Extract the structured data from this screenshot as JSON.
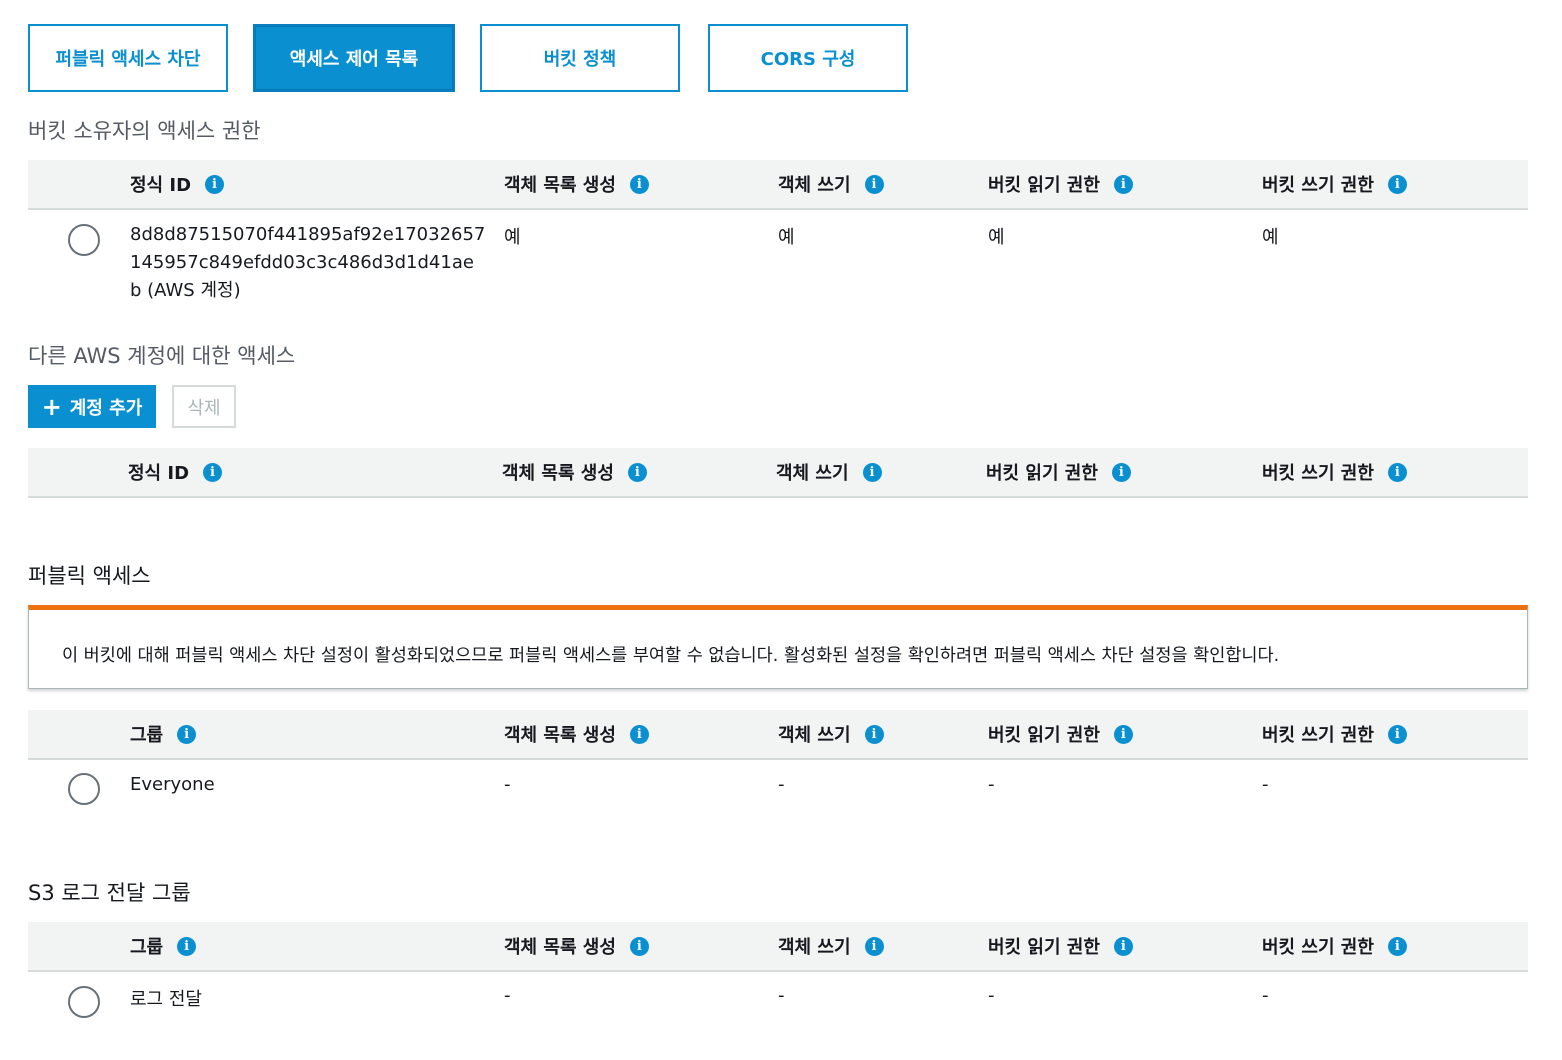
{
  "tabs": [
    {
      "label": "퍼블릭 액세스 차단",
      "active": false
    },
    {
      "label": "액세스 제어 목록",
      "active": true
    },
    {
      "label": "버킷 정책",
      "active": false
    },
    {
      "label": "CORS 구성",
      "active": false
    }
  ],
  "owner_section": {
    "title": "버킷 소유자의 액세스 권한",
    "columns": [
      "정식 ID",
      "객체 목록 생성",
      "객체 쓰기",
      "버킷 읽기 권한",
      "버킷 쓰기 권한"
    ],
    "row": {
      "id_lines": [
        "8d8d87515070f441895af92e17032657",
        "145957c849efdd03c3c486d3d1d41ae",
        "b (AWS 계정)"
      ],
      "list_objects": "예",
      "write_objects": "예",
      "read_bucket": "예",
      "write_bucket": "예"
    }
  },
  "other_accounts": {
    "title": "다른 AWS 계정에 대한 액세스",
    "add_button": "계정 추가",
    "delete_button": "삭제",
    "columns": [
      "정식 ID",
      "객체 목록 생성",
      "객체 쓰기",
      "버킷 읽기 권한",
      "버킷 쓰기 권한"
    ]
  },
  "public_access": {
    "title": "퍼블릭 액세스",
    "alert": "이 버킷에 대해 퍼블릭 액세스 차단 설정이 활성화되었으므로 퍼블릭 액세스를 부여할 수 없습니다. 활성화된 설정을 확인하려면 퍼블릭 액세스 차단 설정을 확인합니다.",
    "columns": [
      "그룹",
      "객체 목록 생성",
      "객체 쓰기",
      "버킷 읽기 권한",
      "버킷 쓰기 권한"
    ],
    "row": {
      "group": "Everyone",
      "list_objects": "-",
      "write_objects": "-",
      "read_bucket": "-",
      "write_bucket": "-"
    }
  },
  "log_delivery": {
    "title": "S3 로그 전달 그룹",
    "columns": [
      "그룹",
      "객체 목록 생성",
      "객체 쓰기",
      "버킷 읽기 권한",
      "버킷 쓰기 권한"
    ],
    "row": {
      "group": "로그 전달",
      "list_objects": "-",
      "write_objects": "-",
      "read_bucket": "-",
      "write_bucket": "-"
    }
  },
  "colors": {
    "accent": "#0a90d1",
    "warning": "#ec7211",
    "header_bg": "#f2f3f3"
  }
}
